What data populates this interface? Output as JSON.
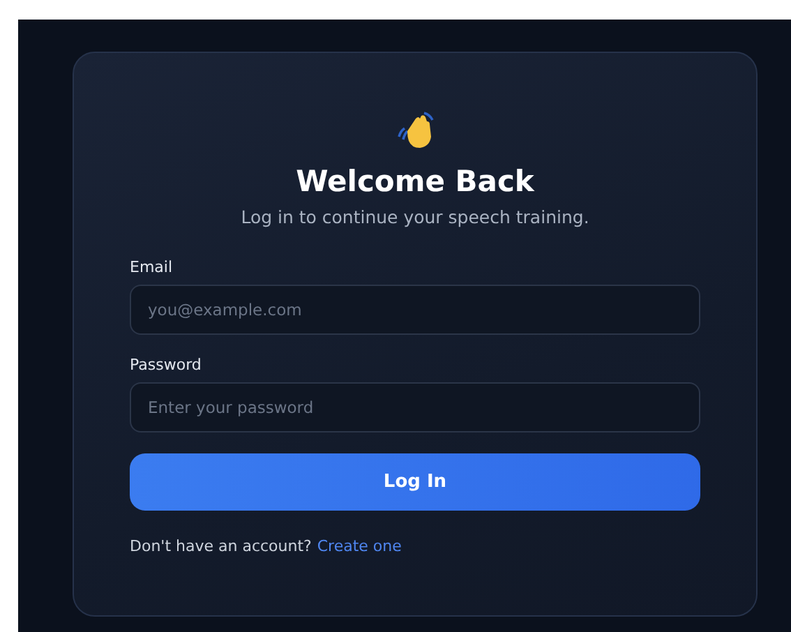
{
  "title": "Welcome Back",
  "subtitle": "Log in to continue your speech training.",
  "fields": [
    {
      "label": "Email",
      "placeholder": "you@example.com"
    },
    {
      "label": "Password",
      "placeholder": "Enter your password"
    }
  ],
  "submit": "Log In",
  "footer": {
    "text": "Don't have an account?",
    "link": "Create one"
  }
}
